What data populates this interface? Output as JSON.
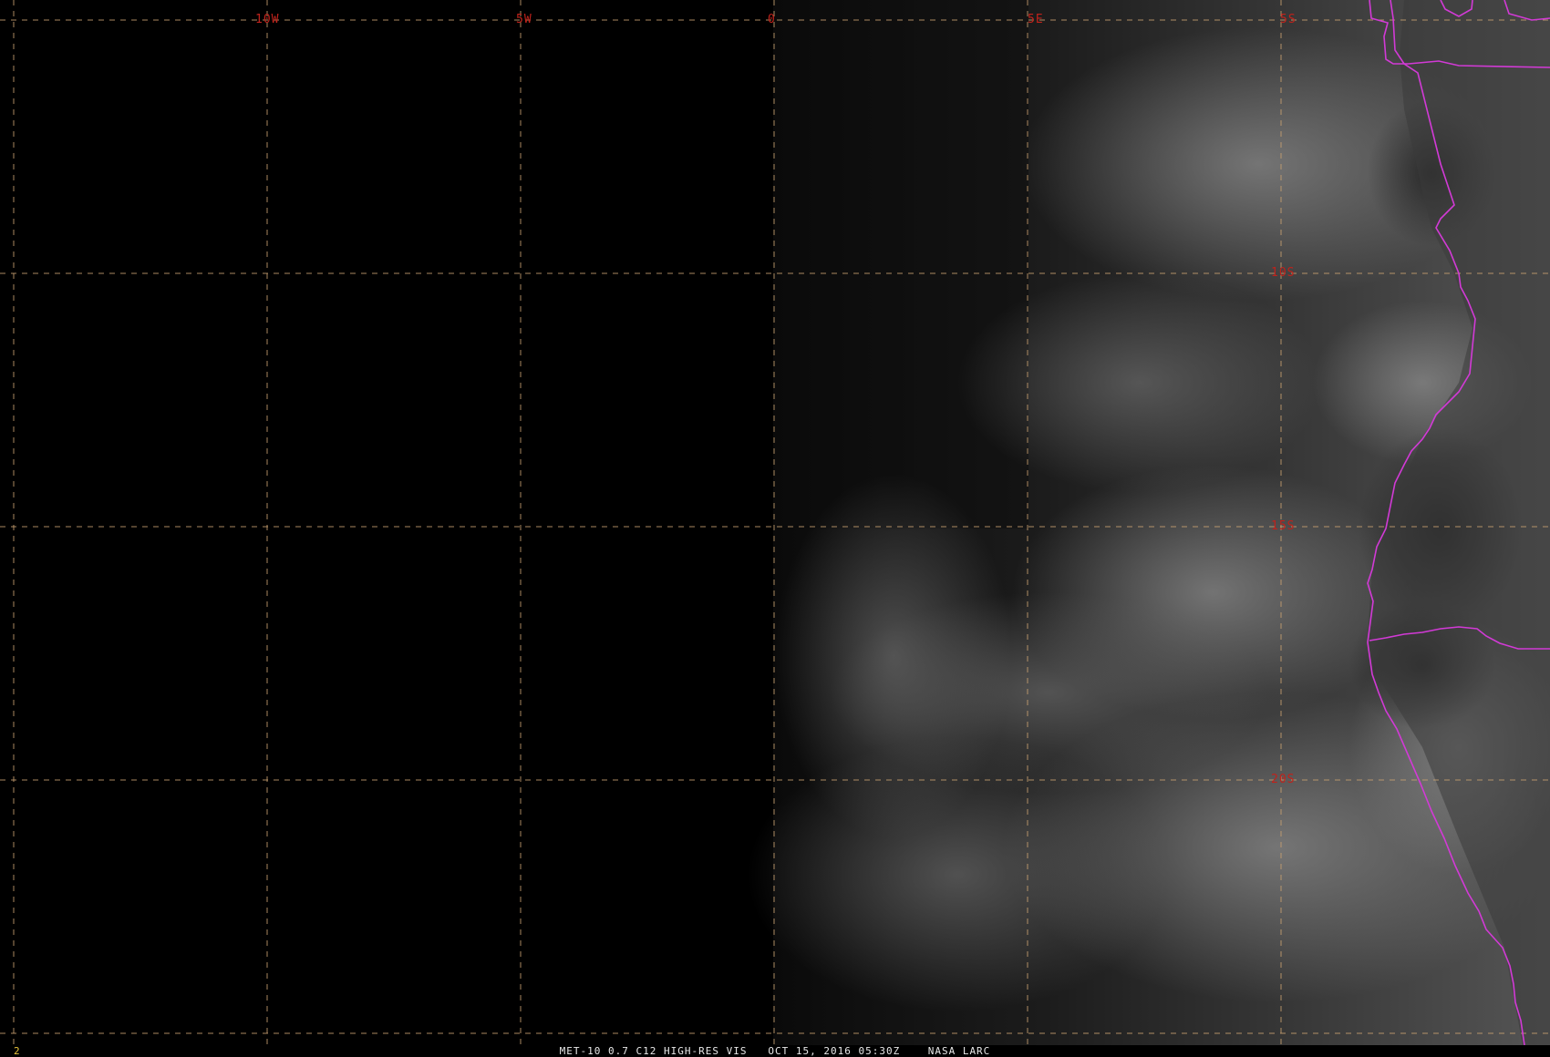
{
  "map": {
    "longitude_labels": [
      "10W",
      "5W",
      "0",
      "5E"
    ],
    "latitude_labels": [
      "5S",
      "10S",
      "15S",
      "20S"
    ],
    "colors": {
      "graticule": "#c8a070",
      "grid_labels": "#c0221b",
      "political_borders": "#d23ad6",
      "caption": "#e8e8e8",
      "frame_number": "#e6c23a"
    }
  },
  "footer": {
    "frame_number": "2",
    "satellite": "MET-10 0.7 C12 HIGH-RES VIS",
    "datetime": "OCT 15, 2016 05:30Z",
    "source": "NASA LARC"
  }
}
